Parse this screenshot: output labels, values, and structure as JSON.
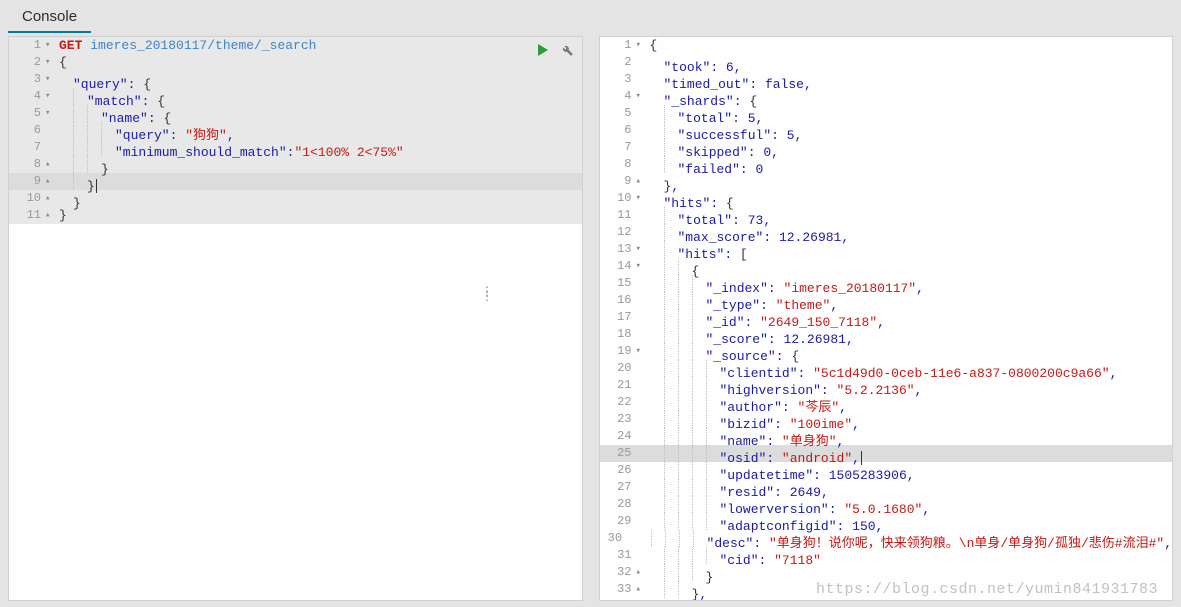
{
  "tab_label": "Console",
  "watermark": "https://blog.csdn.net/yumin841931783",
  "request": {
    "method": "GET",
    "url": "imeres_20180117/theme/_search",
    "body_lines": [
      {
        "n": 2,
        "fold": "▾",
        "indent": 0,
        "tokens": [
          {
            "t": "{",
            "c": "brace"
          }
        ]
      },
      {
        "n": 3,
        "fold": "▾",
        "indent": 1,
        "tokens": [
          {
            "t": "\"query\"",
            "c": "key"
          },
          {
            "t": ": ",
            "c": "punc"
          },
          {
            "t": "{",
            "c": "brace"
          }
        ]
      },
      {
        "n": 4,
        "fold": "▾",
        "indent": 2,
        "tokens": [
          {
            "t": "\"match\"",
            "c": "key"
          },
          {
            "t": ": ",
            "c": "punc"
          },
          {
            "t": "{",
            "c": "brace"
          }
        ]
      },
      {
        "n": 5,
        "fold": "▾",
        "indent": 3,
        "tokens": [
          {
            "t": "\"name\"",
            "c": "key"
          },
          {
            "t": ": ",
            "c": "punc"
          },
          {
            "t": "{",
            "c": "brace"
          }
        ]
      },
      {
        "n": 6,
        "fold": "",
        "indent": 4,
        "tokens": [
          {
            "t": "\"query\"",
            "c": "key"
          },
          {
            "t": ": ",
            "c": "punc"
          },
          {
            "t": "\"狗狗\"",
            "c": "str"
          },
          {
            "t": ",",
            "c": "punc"
          }
        ]
      },
      {
        "n": 7,
        "fold": "",
        "indent": 4,
        "tokens": [
          {
            "t": "\"minimum_should_match\"",
            "c": "key"
          },
          {
            "t": ":",
            "c": "punc"
          },
          {
            "t": "\"1<100% 2<75%\"",
            "c": "str"
          }
        ]
      },
      {
        "n": 8,
        "fold": "▴",
        "indent": 3,
        "tokens": [
          {
            "t": "}",
            "c": "brace"
          }
        ]
      },
      {
        "n": 9,
        "fold": "▴",
        "indent": 2,
        "tokens": [
          {
            "t": "}",
            "c": "brace"
          }
        ],
        "current": true,
        "cursor": true
      },
      {
        "n": 10,
        "fold": "▴",
        "indent": 1,
        "tokens": [
          {
            "t": "}",
            "c": "brace"
          }
        ]
      },
      {
        "n": 11,
        "fold": "▴",
        "indent": 0,
        "tokens": [
          {
            "t": "}",
            "c": "brace"
          }
        ]
      }
    ]
  },
  "response_lines": [
    {
      "n": 1,
      "fold": "▾",
      "indent": 0,
      "tokens": [
        {
          "t": "{",
          "c": "brace"
        }
      ]
    },
    {
      "n": 2,
      "fold": "",
      "indent": 1,
      "tokens": [
        {
          "t": "\"took\"",
          "c": "key"
        },
        {
          "t": ": ",
          "c": "punc"
        },
        {
          "t": "6",
          "c": "num"
        },
        {
          "t": ",",
          "c": "punc"
        }
      ]
    },
    {
      "n": 3,
      "fold": "",
      "indent": 1,
      "tokens": [
        {
          "t": "\"timed_out\"",
          "c": "key"
        },
        {
          "t": ": ",
          "c": "punc"
        },
        {
          "t": "false",
          "c": "bool"
        },
        {
          "t": ",",
          "c": "punc"
        }
      ]
    },
    {
      "n": 4,
      "fold": "▾",
      "indent": 1,
      "tokens": [
        {
          "t": "\"_shards\"",
          "c": "key"
        },
        {
          "t": ": ",
          "c": "punc"
        },
        {
          "t": "{",
          "c": "brace"
        }
      ]
    },
    {
      "n": 5,
      "fold": "",
      "indent": 2,
      "tokens": [
        {
          "t": "\"total\"",
          "c": "key"
        },
        {
          "t": ": ",
          "c": "punc"
        },
        {
          "t": "5",
          "c": "num"
        },
        {
          "t": ",",
          "c": "punc"
        }
      ]
    },
    {
      "n": 6,
      "fold": "",
      "indent": 2,
      "tokens": [
        {
          "t": "\"successful\"",
          "c": "key"
        },
        {
          "t": ": ",
          "c": "punc"
        },
        {
          "t": "5",
          "c": "num"
        },
        {
          "t": ",",
          "c": "punc"
        }
      ]
    },
    {
      "n": 7,
      "fold": "",
      "indent": 2,
      "tokens": [
        {
          "t": "\"skipped\"",
          "c": "key"
        },
        {
          "t": ": ",
          "c": "punc"
        },
        {
          "t": "0",
          "c": "num"
        },
        {
          "t": ",",
          "c": "punc"
        }
      ]
    },
    {
      "n": 8,
      "fold": "",
      "indent": 2,
      "tokens": [
        {
          "t": "\"failed\"",
          "c": "key"
        },
        {
          "t": ": ",
          "c": "punc"
        },
        {
          "t": "0",
          "c": "num"
        }
      ]
    },
    {
      "n": 9,
      "fold": "▴",
      "indent": 1,
      "tokens": [
        {
          "t": "}",
          "c": "brace"
        },
        {
          "t": ",",
          "c": "punc"
        }
      ]
    },
    {
      "n": 10,
      "fold": "▾",
      "indent": 1,
      "tokens": [
        {
          "t": "\"hits\"",
          "c": "key"
        },
        {
          "t": ": ",
          "c": "punc"
        },
        {
          "t": "{",
          "c": "brace"
        }
      ]
    },
    {
      "n": 11,
      "fold": "",
      "indent": 2,
      "tokens": [
        {
          "t": "\"total\"",
          "c": "key"
        },
        {
          "t": ": ",
          "c": "punc"
        },
        {
          "t": "73",
          "c": "num"
        },
        {
          "t": ",",
          "c": "punc"
        }
      ]
    },
    {
      "n": 12,
      "fold": "",
      "indent": 2,
      "tokens": [
        {
          "t": "\"max_score\"",
          "c": "key"
        },
        {
          "t": ": ",
          "c": "punc"
        },
        {
          "t": "12.26981",
          "c": "num"
        },
        {
          "t": ",",
          "c": "punc"
        }
      ]
    },
    {
      "n": 13,
      "fold": "▾",
      "indent": 2,
      "tokens": [
        {
          "t": "\"hits\"",
          "c": "key"
        },
        {
          "t": ": ",
          "c": "punc"
        },
        {
          "t": "[",
          "c": "brace"
        }
      ]
    },
    {
      "n": 14,
      "fold": "▾",
      "indent": 3,
      "tokens": [
        {
          "t": "{",
          "c": "brace"
        }
      ]
    },
    {
      "n": 15,
      "fold": "",
      "indent": 4,
      "tokens": [
        {
          "t": "\"_index\"",
          "c": "key"
        },
        {
          "t": ": ",
          "c": "punc"
        },
        {
          "t": "\"imeres_20180117\"",
          "c": "str"
        },
        {
          "t": ",",
          "c": "punc"
        }
      ]
    },
    {
      "n": 16,
      "fold": "",
      "indent": 4,
      "tokens": [
        {
          "t": "\"_type\"",
          "c": "key"
        },
        {
          "t": ": ",
          "c": "punc"
        },
        {
          "t": "\"theme\"",
          "c": "str"
        },
        {
          "t": ",",
          "c": "punc"
        }
      ]
    },
    {
      "n": 17,
      "fold": "",
      "indent": 4,
      "tokens": [
        {
          "t": "\"_id\"",
          "c": "key"
        },
        {
          "t": ": ",
          "c": "punc"
        },
        {
          "t": "\"2649_150_7118\"",
          "c": "str"
        },
        {
          "t": ",",
          "c": "punc"
        }
      ]
    },
    {
      "n": 18,
      "fold": "",
      "indent": 4,
      "tokens": [
        {
          "t": "\"_score\"",
          "c": "key"
        },
        {
          "t": ": ",
          "c": "punc"
        },
        {
          "t": "12.26981",
          "c": "num"
        },
        {
          "t": ",",
          "c": "punc"
        }
      ]
    },
    {
      "n": 19,
      "fold": "▾",
      "indent": 4,
      "tokens": [
        {
          "t": "\"_source\"",
          "c": "key"
        },
        {
          "t": ": ",
          "c": "punc"
        },
        {
          "t": "{",
          "c": "brace"
        }
      ]
    },
    {
      "n": 20,
      "fold": "",
      "indent": 5,
      "tokens": [
        {
          "t": "\"clientid\"",
          "c": "key"
        },
        {
          "t": ": ",
          "c": "punc"
        },
        {
          "t": "\"5c1d49d0-0ceb-11e6-a837-0800200c9a66\"",
          "c": "str"
        },
        {
          "t": ",",
          "c": "punc"
        }
      ]
    },
    {
      "n": 21,
      "fold": "",
      "indent": 5,
      "tokens": [
        {
          "t": "\"highversion\"",
          "c": "key"
        },
        {
          "t": ": ",
          "c": "punc"
        },
        {
          "t": "\"5.2.2136\"",
          "c": "str"
        },
        {
          "t": ",",
          "c": "punc"
        }
      ]
    },
    {
      "n": 22,
      "fold": "",
      "indent": 5,
      "tokens": [
        {
          "t": "\"author\"",
          "c": "key"
        },
        {
          "t": ": ",
          "c": "punc"
        },
        {
          "t": "\"芩辰\"",
          "c": "str"
        },
        {
          "t": ",",
          "c": "punc"
        }
      ]
    },
    {
      "n": 23,
      "fold": "",
      "indent": 5,
      "tokens": [
        {
          "t": "\"bizid\"",
          "c": "key"
        },
        {
          "t": ": ",
          "c": "punc"
        },
        {
          "t": "\"100ime\"",
          "c": "str"
        },
        {
          "t": ",",
          "c": "punc"
        }
      ]
    },
    {
      "n": 24,
      "fold": "",
      "indent": 5,
      "tokens": [
        {
          "t": "\"name\"",
          "c": "key"
        },
        {
          "t": ": ",
          "c": "punc"
        },
        {
          "t": "\"单身狗\"",
          "c": "str"
        },
        {
          "t": ",",
          "c": "punc"
        }
      ]
    },
    {
      "n": 25,
      "fold": "",
      "indent": 5,
      "current": true,
      "cursor": true,
      "tokens": [
        {
          "t": "\"osid\"",
          "c": "key"
        },
        {
          "t": ": ",
          "c": "punc"
        },
        {
          "t": "\"android\"",
          "c": "str"
        },
        {
          "t": ",",
          "c": "punc"
        }
      ]
    },
    {
      "n": 26,
      "fold": "",
      "indent": 5,
      "tokens": [
        {
          "t": "\"updatetime\"",
          "c": "key"
        },
        {
          "t": ": ",
          "c": "punc"
        },
        {
          "t": "1505283906",
          "c": "num"
        },
        {
          "t": ",",
          "c": "punc"
        }
      ]
    },
    {
      "n": 27,
      "fold": "",
      "indent": 5,
      "tokens": [
        {
          "t": "\"resid\"",
          "c": "key"
        },
        {
          "t": ": ",
          "c": "punc"
        },
        {
          "t": "2649",
          "c": "num"
        },
        {
          "t": ",",
          "c": "punc"
        }
      ]
    },
    {
      "n": 28,
      "fold": "",
      "indent": 5,
      "tokens": [
        {
          "t": "\"lowerversion\"",
          "c": "key"
        },
        {
          "t": ": ",
          "c": "punc"
        },
        {
          "t": "\"5.0.1680\"",
          "c": "str"
        },
        {
          "t": ",",
          "c": "punc"
        }
      ]
    },
    {
      "n": 29,
      "fold": "",
      "indent": 5,
      "tokens": [
        {
          "t": "\"adaptconfigid\"",
          "c": "key"
        },
        {
          "t": ": ",
          "c": "punc"
        },
        {
          "t": "150",
          "c": "num"
        },
        {
          "t": ",",
          "c": "punc"
        }
      ]
    },
    {
      "n": 30,
      "fold": "",
      "indent": 5,
      "tokens": [
        {
          "t": "\"desc\"",
          "c": "key"
        },
        {
          "t": ": ",
          "c": "punc"
        },
        {
          "t": "\"单身狗！说你呢，快来领狗粮。\\n单身/单身狗/孤独/悲伤#流泪#\"",
          "c": "str"
        },
        {
          "t": ",",
          "c": "punc"
        }
      ]
    },
    {
      "n": 31,
      "fold": "",
      "indent": 5,
      "tokens": [
        {
          "t": "\"cid\"",
          "c": "key"
        },
        {
          "t": ": ",
          "c": "punc"
        },
        {
          "t": "\"7118\"",
          "c": "str"
        }
      ]
    },
    {
      "n": 32,
      "fold": "▴",
      "indent": 4,
      "tokens": [
        {
          "t": "}",
          "c": "brace"
        }
      ]
    },
    {
      "n": 33,
      "fold": "▴",
      "indent": 3,
      "tokens": [
        {
          "t": "}",
          "c": "brace"
        },
        {
          "t": ",",
          "c": "punc"
        }
      ]
    }
  ]
}
